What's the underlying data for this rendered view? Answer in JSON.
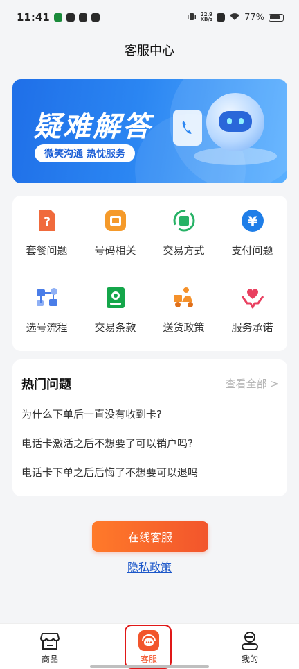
{
  "status_bar": {
    "time": "11:41",
    "net_speed_value": "22.9",
    "net_speed_unit": "KB/s",
    "battery": "77%"
  },
  "header": {
    "title": "客服中心"
  },
  "banner": {
    "title": "疑难解答",
    "subtitle": "微笑沟通 热忱服务"
  },
  "categories": [
    {
      "label": "套餐问题",
      "icon": "document-question-icon",
      "color": "#f06a3c"
    },
    {
      "label": "号码相关",
      "icon": "sim-card-icon",
      "color": "#f59a2a"
    },
    {
      "label": "交易方式",
      "icon": "exchange-cycle-icon",
      "color": "#27b266"
    },
    {
      "label": "支付问题",
      "icon": "yuan-coin-icon",
      "color": "#1f7ee8"
    },
    {
      "label": "选号流程",
      "icon": "flowchart-icon",
      "color": "#4a7de8"
    },
    {
      "label": "交易条款",
      "icon": "terms-book-icon",
      "color": "#14a64a"
    },
    {
      "label": "送货政策",
      "icon": "delivery-scooter-icon",
      "color": "#f5912a"
    },
    {
      "label": "服务承诺",
      "icon": "heart-hands-icon",
      "color": "#e94060"
    }
  ],
  "hot": {
    "title": "热门问题",
    "more": "查看全部 >",
    "questions": [
      "为什么下单后一直没有收到卡?",
      "电话卡激活之后不想要了可以销户吗?",
      "电话卡下单之后后悔了不想要可以退吗"
    ]
  },
  "actions": {
    "online_service": "在线客服",
    "privacy": "隐私政策"
  },
  "tabs": [
    {
      "label": "商品",
      "icon": "store-icon"
    },
    {
      "label": "客服",
      "icon": "customer-service-icon",
      "active": true
    },
    {
      "label": "我的",
      "icon": "profile-icon"
    }
  ],
  "colors": {
    "accent": "#f2552c",
    "link": "#1a56c9",
    "banner": "#2b86f2"
  }
}
